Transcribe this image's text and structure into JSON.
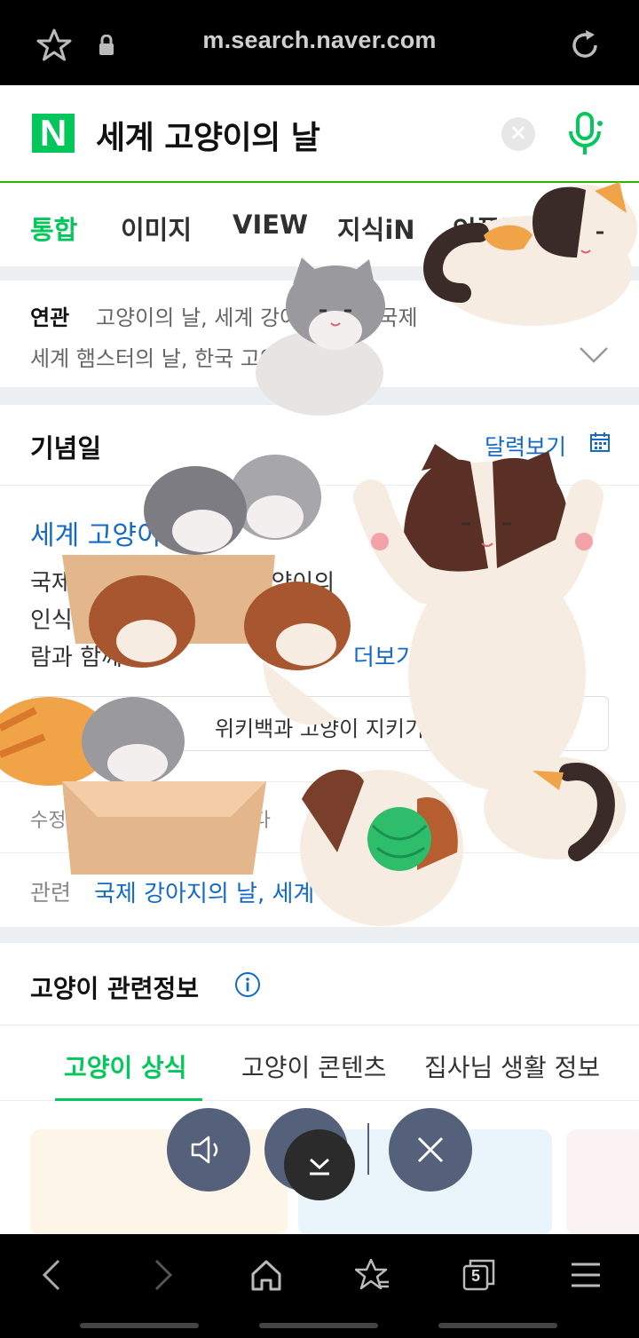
{
  "browser": {
    "url": "m.search.naver.com"
  },
  "search": {
    "logo": "N",
    "query": "세계 고양이의 날"
  },
  "tabs": [
    {
      "label": "통합",
      "active": true
    },
    {
      "label": "이미지",
      "active": false
    },
    {
      "label": "VIEW",
      "active": false
    },
    {
      "label": "지식iN",
      "active": false
    },
    {
      "label": "인플루언서",
      "active": false
    }
  ],
  "related": {
    "label": "연관",
    "line1": "고양이의 날, 세계 강아지의 날, 국제",
    "line2": "세계 햄스터의 날, 한국 고양이의 날"
  },
  "anniversary": {
    "title": "기념일",
    "calendar_link": "달력보기",
    "event_title": "세계 고양이의 날",
    "desc_lines": [
      "국제동물복지기금에서 고양이의",
      "인식 개선을 위해 제정한 기간",
      "람과 함께"
    ],
    "more": "더보기",
    "wiki_button": "위키백과 고양이 지키기",
    "source": "수정 요청을 하실 수 있습니다",
    "related_label": "관련",
    "related_links": "국제 강아지의 날, 세계"
  },
  "cat_info": {
    "title": "고양이 관련정보",
    "sub_tabs": [
      {
        "label": "고양이 상식",
        "active": true
      },
      {
        "label": "고양이 콘텐츠",
        "active": false
      },
      {
        "label": "집사님 생활 정보",
        "active": false
      }
    ]
  },
  "colors": {
    "naver_green": "#03c75a",
    "link_blue": "#1469c7",
    "fab_slate": "#55607a"
  },
  "bottom_nav": {
    "tab_count": "5"
  }
}
